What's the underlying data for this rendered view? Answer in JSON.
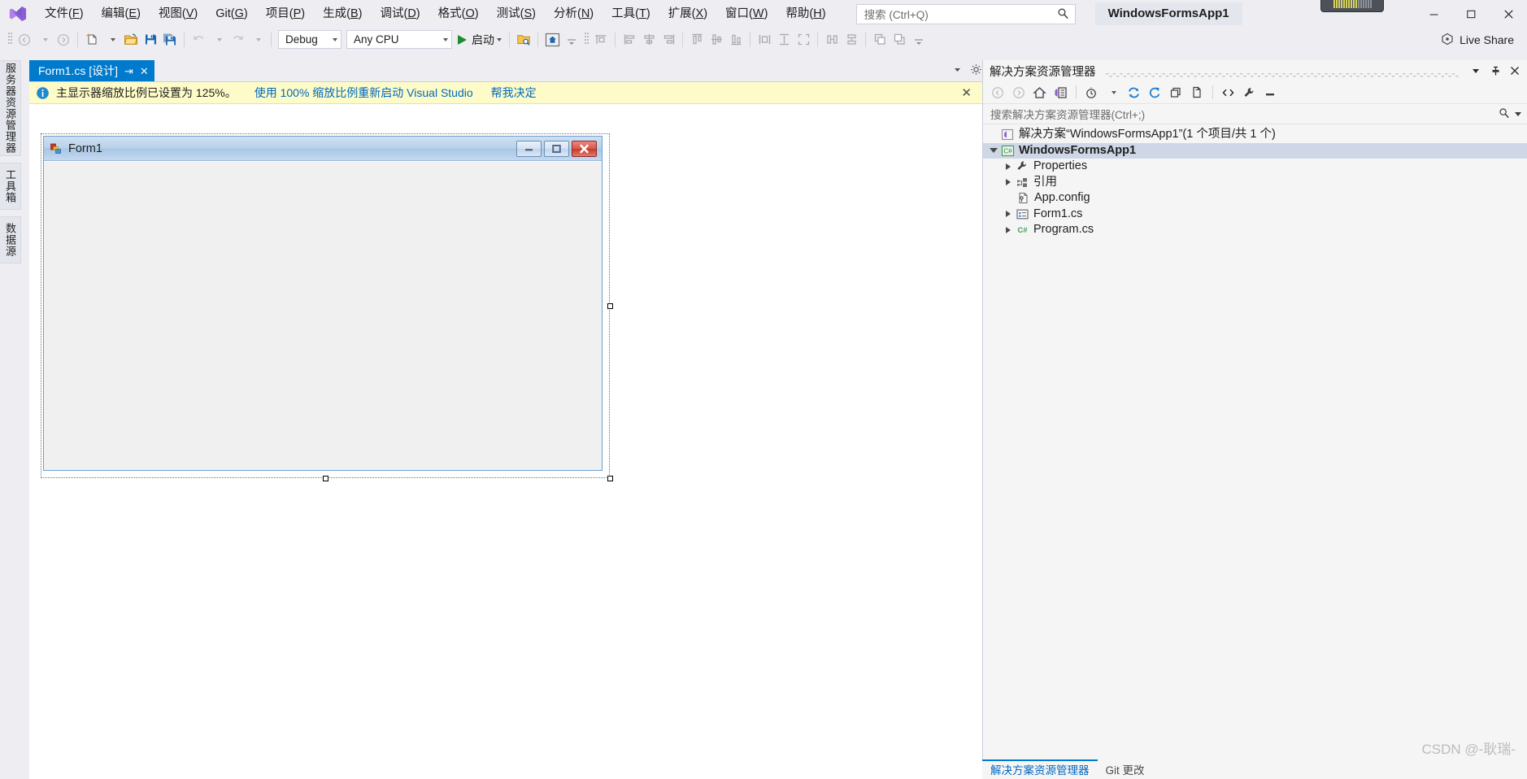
{
  "window": {
    "app_title": "WindowsFormsApp1",
    "minimize_icon": "minimize-icon",
    "maximize_icon": "maximize-icon",
    "close_icon": "close-icon"
  },
  "menubar": {
    "logo": "visual-studio-logo",
    "items": [
      {
        "name": "file",
        "pre": "文件(",
        "key": "F",
        "post": ")"
      },
      {
        "name": "edit",
        "pre": "编辑(",
        "key": "E",
        "post": ")"
      },
      {
        "name": "view",
        "pre": "视图(",
        "key": "V",
        "post": ")"
      },
      {
        "name": "git",
        "pre": "Git(",
        "key": "G",
        "post": ")"
      },
      {
        "name": "project",
        "pre": "项目(",
        "key": "P",
        "post": ")"
      },
      {
        "name": "build",
        "pre": "生成(",
        "key": "B",
        "post": ")"
      },
      {
        "name": "debug",
        "pre": "调试(",
        "key": "D",
        "post": ")"
      },
      {
        "name": "format",
        "pre": "格式(",
        "key": "O",
        "post": ")"
      },
      {
        "name": "test",
        "pre": "测试(",
        "key": "S",
        "post": ")"
      },
      {
        "name": "analyze",
        "pre": "分析(",
        "key": "N",
        "post": ")"
      },
      {
        "name": "tools",
        "pre": "工具(",
        "key": "T",
        "post": ")"
      },
      {
        "name": "extensions",
        "pre": "扩展(",
        "key": "X",
        "post": ")"
      },
      {
        "name": "window",
        "pre": "窗口(",
        "key": "W",
        "post": ")"
      },
      {
        "name": "help",
        "pre": "帮助(",
        "key": "H",
        "post": ")"
      }
    ]
  },
  "search": {
    "placeholder": "搜索 (Ctrl+Q)",
    "icon": "search-icon"
  },
  "toolbar": {
    "nav_back_icon": "navigate-back-icon",
    "nav_forward_icon": "navigate-forward-icon",
    "new_item_icon": "new-item-icon",
    "open_file_icon": "open-file-icon",
    "save_icon": "save-icon",
    "save_all_icon": "save-all-icon",
    "undo_icon": "undo-icon",
    "redo_icon": "redo-icon",
    "config_value": "Debug",
    "platform_value": "Any CPU",
    "start_label": "启动",
    "start_icon": "play-icon",
    "folder_search_icon": "folder-search-icon",
    "home_icon": "home-icon",
    "align_icons": [
      "align-to-grid-icon",
      "align-lefts-icon",
      "align-centers-icon",
      "align-rights-icon",
      "align-tops-icon",
      "align-middles-icon",
      "align-bottoms-icon",
      "make-same-width-icon",
      "make-same-height-icon",
      "make-same-size-icon",
      "horizontal-spacing-icon",
      "vertical-spacing-icon",
      "bring-to-front-icon",
      "send-to-back-icon"
    ],
    "live_share_label": "Live Share",
    "live_share_icon": "live-share-icon"
  },
  "left_strip": {
    "tabs": [
      {
        "name": "server-explorer",
        "label": "服务器资源管理器"
      },
      {
        "name": "toolbox",
        "label": "工具箱"
      },
      {
        "name": "data-sources",
        "label": "数据源"
      }
    ]
  },
  "document_tab": {
    "label": "Form1.cs [设计]",
    "pin_icon": "pin-icon",
    "close_icon": "close-icon",
    "dropdown_icon": "chevron-down-icon",
    "settings_icon": "gear-icon"
  },
  "info_bar": {
    "icon": "info-icon",
    "message": "主显示器缩放比例已设置为 125%。",
    "link_restart": "使用 100% 缩放比例重新启动 Visual Studio",
    "link_decide": "帮我决定",
    "close_icon": "close-icon"
  },
  "designer": {
    "form_title": "Form1",
    "form_icon": "windows-form-icon",
    "minimize_icon": "minimize-icon",
    "maximize_icon": "maximize-icon",
    "close_icon": "close-icon"
  },
  "solution_explorer": {
    "title": "解决方案资源管理器",
    "header_icons": [
      "chevron-down-icon",
      "pin-icon",
      "close-icon"
    ],
    "toolbar_icons": [
      "back-icon",
      "forward-icon",
      "home-icon",
      "solution-explorer-icon",
      "pending-changes-icon",
      "sync-icon",
      "refresh-icon",
      "collapse-all-icon",
      "show-all-files-icon",
      "view-code-icon",
      "properties-icon",
      "preview-icon"
    ],
    "search_placeholder": "搜索解决方案资源管理器(Ctrl+;)",
    "search_icon": "search-icon",
    "search_dropdown_icon": "chevron-down-icon",
    "tree": [
      {
        "name": "solution-node",
        "label": "解决方案“WindowsFormsApp1”(1 个项目/共 1 个)",
        "icon": "solution-icon",
        "indent": 1,
        "twisty": "none",
        "bold": false,
        "selected": false
      },
      {
        "name": "project-node",
        "label": "WindowsFormsApp1",
        "icon": "csharp-project-icon",
        "indent": 1,
        "twisty": "down",
        "bold": true,
        "selected": true
      },
      {
        "name": "properties-node",
        "label": "Properties",
        "icon": "wrench-icon",
        "indent": 2,
        "twisty": "right",
        "bold": false,
        "selected": false
      },
      {
        "name": "references-node",
        "label": "引用",
        "icon": "references-icon",
        "indent": 2,
        "twisty": "right",
        "bold": false,
        "selected": false
      },
      {
        "name": "appconfig-node",
        "label": "App.config",
        "icon": "config-file-icon",
        "indent": 2,
        "twisty": "none",
        "bold": false,
        "selected": false
      },
      {
        "name": "form1-node",
        "label": "Form1.cs",
        "icon": "form-file-icon",
        "indent": 2,
        "twisty": "right",
        "bold": false,
        "selected": false
      },
      {
        "name": "program-node",
        "label": "Program.cs",
        "icon": "csharp-file-icon",
        "indent": 2,
        "twisty": "right",
        "bold": false,
        "selected": false
      }
    ]
  },
  "bottom_tabs": [
    {
      "name": "solution-explorer-tab",
      "label": "解决方案资源管理器",
      "active": true
    },
    {
      "name": "git-changes-tab",
      "label": "Git 更改",
      "active": false
    }
  ],
  "watermark": "CSDN @-耿瑞-",
  "colors": {
    "accent": "#007acc",
    "info_bar_bg": "#fdfcc8",
    "link": "#0067c0",
    "selection": "#cfd6e6",
    "close_red": "#c8392c"
  }
}
